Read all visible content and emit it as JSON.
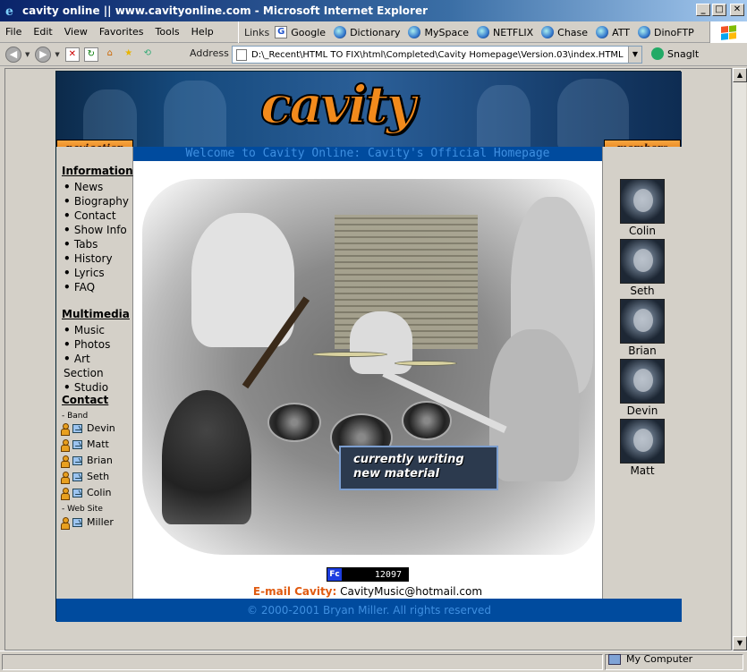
{
  "window": {
    "title": "cavity online || www.cavityonline.com - Microsoft Internet Explorer",
    "controls": [
      "_",
      "□",
      "✕"
    ]
  },
  "menu": [
    "File",
    "Edit",
    "View",
    "Favorites",
    "Tools",
    "Help"
  ],
  "links_bar": {
    "label": "Links",
    "items": [
      "Google",
      "Dictionary",
      "MySpace",
      "NETFLIX",
      "Chase",
      "ATT",
      "DinoFTP"
    ]
  },
  "address": {
    "label": "Address",
    "value": "D:\\_Recent\\HTML TO FIX\\html\\Completed\\Cavity Homepage\\Version.03\\index.HTML",
    "snagit": "SnagIt"
  },
  "site": {
    "logo_text": "cavity",
    "nav_header": "navigation",
    "members_header": "members",
    "welcome": "Welcome to Cavity Online: Cavity's Official Homepage",
    "information": {
      "heading": "Information",
      "items": [
        "News",
        "Biography",
        "Contact",
        "Show Info",
        "Tabs",
        "History",
        "Lyrics",
        "FAQ"
      ]
    },
    "multimedia": {
      "heading": "Multimedia",
      "items": [
        "Music",
        "Photos",
        "Art Section",
        "Studio"
      ]
    },
    "contact": {
      "heading": "Contact",
      "band_label": "- Band",
      "band": [
        "Devin",
        "Matt",
        "Brian",
        "Seth",
        "Colin"
      ],
      "website_label": "- Web Site",
      "website": [
        "Miller"
      ]
    },
    "caption": {
      "line1": "currently writing",
      "line2": "new material"
    },
    "counter": {
      "badge": "Fc",
      "value": "12097"
    },
    "email": {
      "label": "E-mail Cavity:",
      "address": "CavityMusic@hotmail.com"
    },
    "footer": "© 2000-2001 Bryan Miller. All rights reserved",
    "members": [
      "Colin",
      "Seth",
      "Brian",
      "Devin",
      "Matt"
    ]
  },
  "status": {
    "zone": "My Computer"
  },
  "colors": {
    "accent_orange": "#f28a1c",
    "site_blue": "#004b9e",
    "email_label": "#e05a10"
  }
}
